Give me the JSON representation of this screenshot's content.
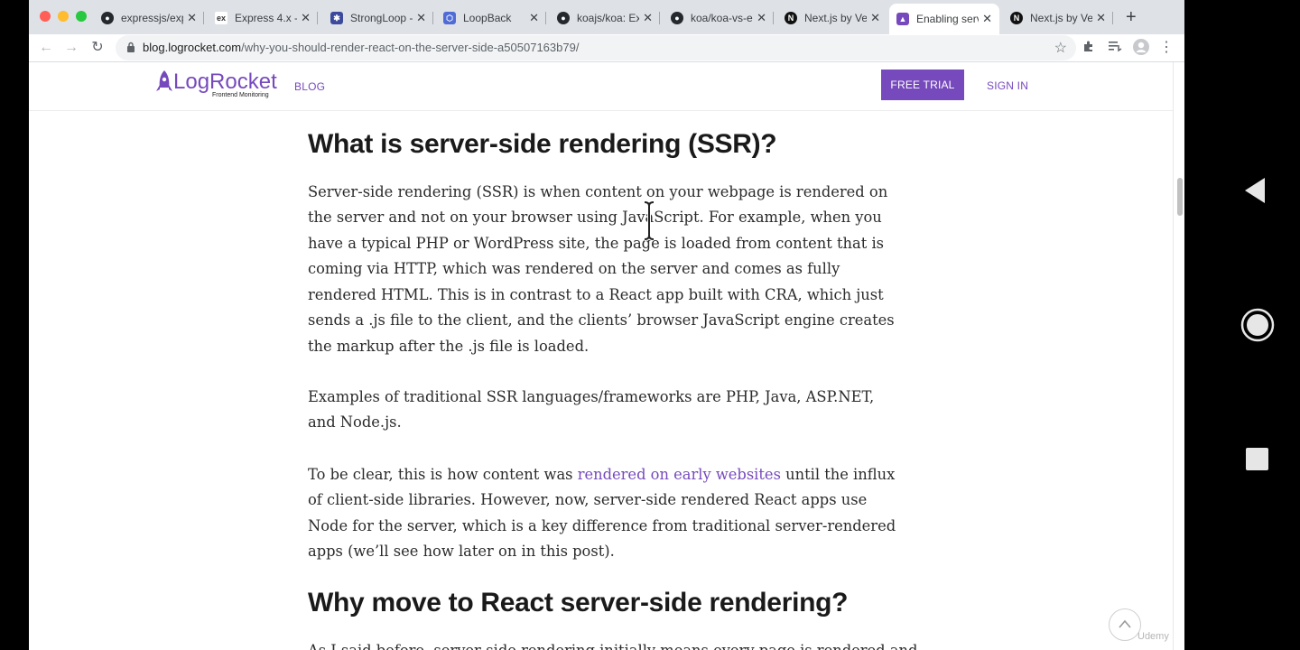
{
  "browser": {
    "tabs": [
      {
        "title": "expressjs/exp",
        "icon": "github-icon"
      },
      {
        "title": "Express 4.x -",
        "icon": "express-icon"
      },
      {
        "title": "StrongLoop -",
        "icon": "strongloop-icon"
      },
      {
        "title": "LoopBack",
        "icon": "loopback-icon"
      },
      {
        "title": "koajs/koa: Exp",
        "icon": "github-icon"
      },
      {
        "title": "koa/koa-vs-e",
        "icon": "github-icon"
      },
      {
        "title": "Next.js by Ve",
        "icon": "nextjs-icon"
      },
      {
        "title": "Enabling serv",
        "icon": "logrocket-icon",
        "active": true
      },
      {
        "title": "Next.js by Ve",
        "icon": "nextjs-icon"
      }
    ],
    "url_host": "blog.logrocket.com",
    "url_path": "/why-you-should-render-react-on-the-server-side-a50507163b79/"
  },
  "site": {
    "logo_text": "LogRocket",
    "logo_sub": "Frontend Monitoring",
    "nav_blog": "BLOG",
    "free_trial": "FREE TRIAL",
    "sign_in": "SIGN IN"
  },
  "article": {
    "heading1": "What is server-side rendering (SSR)?",
    "p1": "Server-side rendering (SSR) is when content on your webpage is rendered on the server and not on your browser using JavaScript. For example, when you have a typical PHP or WordPress site, the page is loaded from content that is coming via HTTP, which was rendered on the server and comes as fully rendered HTML. This is in contrast to a React app built with CRA, which just sends a .js file to the client, and the clients’ browser JavaScript engine creates the markup after the .js file is loaded.",
    "p2": "Examples of traditional SSR languages/frameworks are PHP, Java, ASP.NET, and Node.js.",
    "p3_before": "To be clear, this is how content was ",
    "p3_link": "rendered on early websites",
    "p3_after": " until the influx of client-side libraries. However, now, server-side rendered React apps use Node for the server, which is a key difference from traditional server-rendered apps (we’ll see how later on in this post).",
    "heading2": "Why move to React server-side rendering?",
    "p4_partial": "As I said before, server-side rendering initially means every page is rendered and"
  },
  "overlay": {
    "watermark": "Udemy"
  },
  "colors": {
    "accent": "#764abc"
  }
}
